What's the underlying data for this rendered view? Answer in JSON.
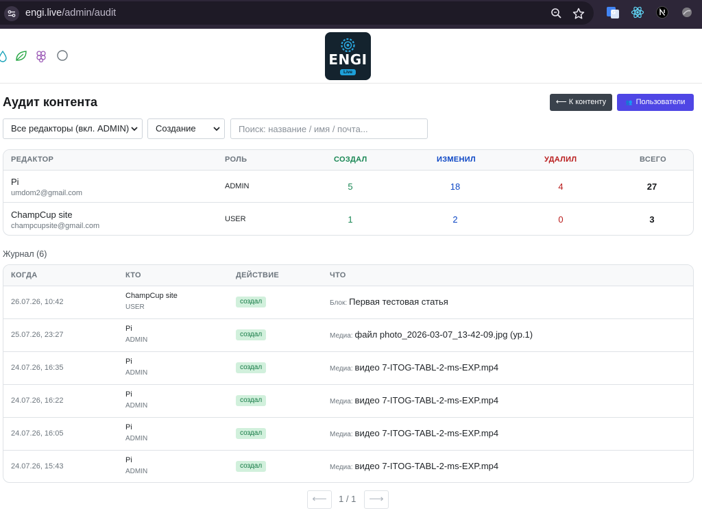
{
  "browser": {
    "url_domain": "engi.live",
    "url_path": "/admin/audit"
  },
  "logo": {
    "text": "ENGI",
    "sub": "Live"
  },
  "page": {
    "title": "Аудит контента",
    "back_button": "⟵ К контенту",
    "users_button": "Пользователи"
  },
  "filters": {
    "editor_select": "Все редакторы (вкл. ADMIN)",
    "action_select": "Создание",
    "search_placeholder": "Поиск: название / имя / почта..."
  },
  "summary": {
    "headers": {
      "editor": "РЕДАКТОР",
      "role": "РОЛЬ",
      "created": "СОЗДАЛ",
      "changed": "ИЗМЕНИЛ",
      "deleted": "УДАЛИЛ",
      "total": "ВСЕГО"
    },
    "rows": [
      {
        "name": "Pi",
        "email": "umdom2@gmail.com",
        "role": "ADMIN",
        "created": "5",
        "changed": "18",
        "deleted": "4",
        "total": "27"
      },
      {
        "name": "ChampCup site",
        "email": "champcupsite@gmail.com",
        "role": "USER",
        "created": "1",
        "changed": "2",
        "deleted": "0",
        "total": "3"
      }
    ]
  },
  "journal": {
    "label": "Журнал (6)",
    "headers": {
      "when": "КОГДА",
      "who": "КТО",
      "action": "ДЕЙСТВИЕ",
      "what": "ЧТО"
    },
    "rows": [
      {
        "date": "26.07.26, 10:42",
        "who": "ChampCup site",
        "role": "USER",
        "action": "создал",
        "kind": "Блок:",
        "what": "Первая тестовая статья"
      },
      {
        "date": "25.07.26, 23:27",
        "who": "Pi",
        "role": "ADMIN",
        "action": "создал",
        "kind": "Медиа:",
        "what": "файл photo_2026-03-07_13-42-09.jpg (ур.1)"
      },
      {
        "date": "24.07.26, 16:35",
        "who": "Pi",
        "role": "ADMIN",
        "action": "создал",
        "kind": "Медиа:",
        "what": "видео 7-ITOG-TABL-2-ms-EXP.mp4"
      },
      {
        "date": "24.07.26, 16:22",
        "who": "Pi",
        "role": "ADMIN",
        "action": "создал",
        "kind": "Медиа:",
        "what": "видео 7-ITOG-TABL-2-ms-EXP.mp4"
      },
      {
        "date": "24.07.26, 16:05",
        "who": "Pi",
        "role": "ADMIN",
        "action": "создал",
        "kind": "Медиа:",
        "what": "видео 7-ITOG-TABL-2-ms-EXP.mp4"
      },
      {
        "date": "24.07.26, 15:43",
        "who": "Pi",
        "role": "ADMIN",
        "action": "создал",
        "kind": "Медиа:",
        "what": "видео 7-ITOG-TABL-2-ms-EXP.mp4"
      }
    ]
  },
  "pagination": {
    "prev": "⟵",
    "info": "1 / 1",
    "next": "⟶"
  }
}
